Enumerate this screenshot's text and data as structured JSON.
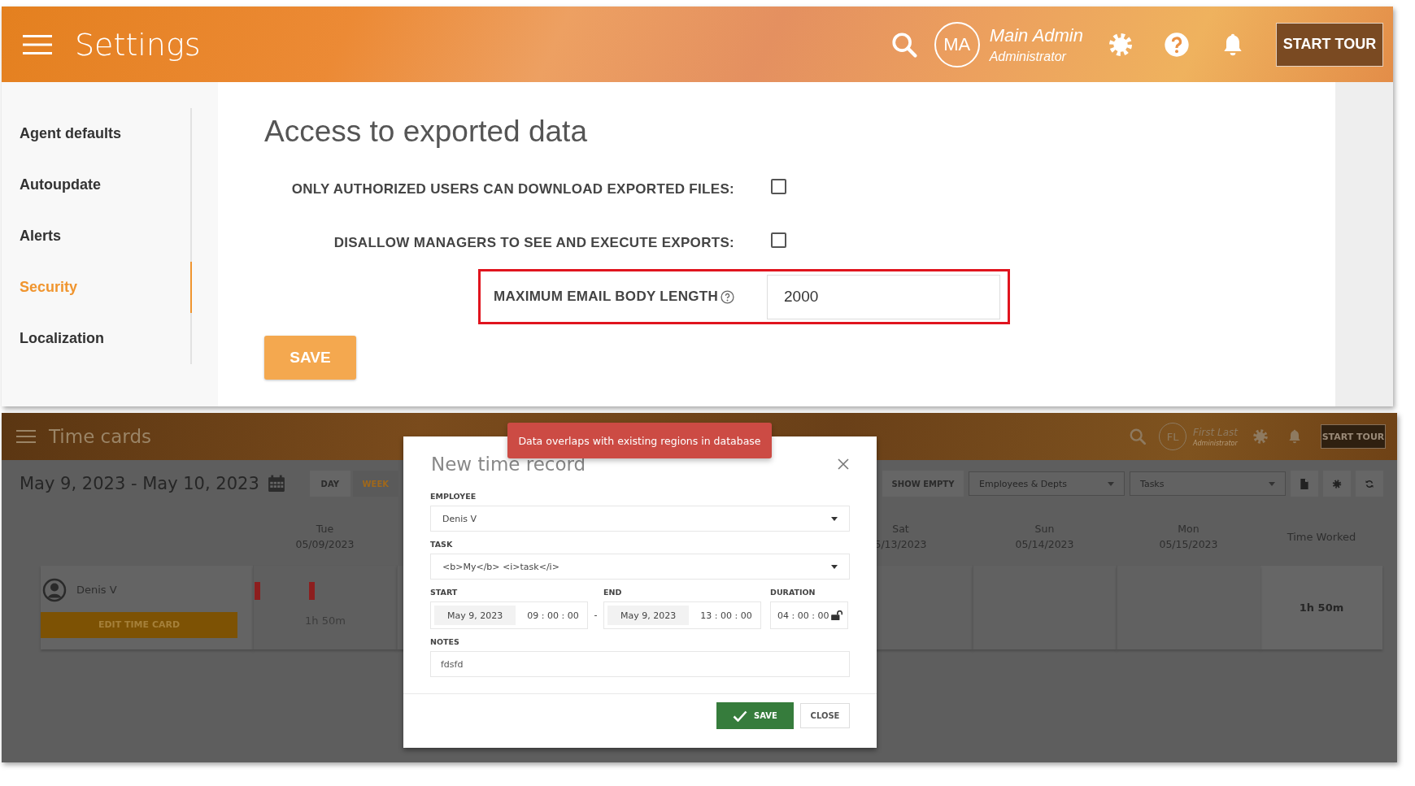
{
  "settings": {
    "header": {
      "title": "Settings",
      "user_initials": "MA",
      "user_name": "Main Admin",
      "user_role": "Administrator",
      "tour_button": "START TOUR"
    },
    "sidebar": [
      {
        "label": "Agent defaults",
        "selected": false
      },
      {
        "label": "Autoupdate",
        "selected": false
      },
      {
        "label": "Alerts",
        "selected": false
      },
      {
        "label": "Security",
        "selected": true
      },
      {
        "label": "Localization",
        "selected": false
      }
    ],
    "page_title": "Access to exported data",
    "fields": [
      {
        "kind": "checkbox",
        "label": "ONLY AUTHORIZED USERS CAN DOWNLOAD EXPORTED FILES:",
        "checked": false,
        "highlighted": false
      },
      {
        "kind": "checkbox",
        "label": "DISALLOW MANAGERS TO SEE AND EXECUTE EXPORTS:",
        "checked": false,
        "highlighted": false
      },
      {
        "kind": "number",
        "label": "MAXIMUM EMAIL BODY LENGTH",
        "value": "2000",
        "highlighted": true
      }
    ],
    "save_button": "SAVE"
  },
  "timecards": {
    "header": {
      "title": "Time cards",
      "user_initials": "FL",
      "user_name": "First Last",
      "user_role": "Administrator",
      "tour_button": "START TOUR"
    },
    "date_range": "May 9, 2023 - May 10, 2023",
    "view_tabs": [
      {
        "label": "DAY",
        "selected": false
      },
      {
        "label": "WEEK",
        "selected": true
      }
    ],
    "show_empty_button": "SHOW EMPTY",
    "filters": [
      {
        "value": "Employees & Depts"
      },
      {
        "value": "Tasks"
      }
    ],
    "days": [
      {
        "day": "Tue",
        "date": "05/09/2023"
      },
      {
        "day": "Sat",
        "date": "5/13/2023"
      },
      {
        "day": "Sun",
        "date": "05/14/2023"
      },
      {
        "day": "Mon",
        "date": "05/15/2023"
      }
    ],
    "time_worked_heading": "Time Worked",
    "rows": [
      {
        "name": "Denis V",
        "edit_button": "EDIT TIME CARD",
        "first_day_total": "1h 50m",
        "total": "1h 50m"
      }
    ],
    "toast": "Data overlaps with existing regions in database",
    "dialog": {
      "title": "New time record",
      "employee_label": "EMPLOYEE",
      "employee": "Denis V",
      "task_label": "TASK",
      "task": "<b>My</b> <i>task</i>",
      "start_label": "START",
      "start_date": "May 9, 2023",
      "start_time": "09 : 00 : 00",
      "separator": "-",
      "end_label": "END",
      "end_date": "May 9, 2023",
      "end_time": "13 : 00 : 00",
      "duration_label": "DURATION",
      "duration": "04 : 00 : 00",
      "duration_locked": false,
      "notes_label": "NOTES",
      "notes": "fdsfd",
      "save_button": "SAVE",
      "close_button": "CLOSE"
    }
  }
}
